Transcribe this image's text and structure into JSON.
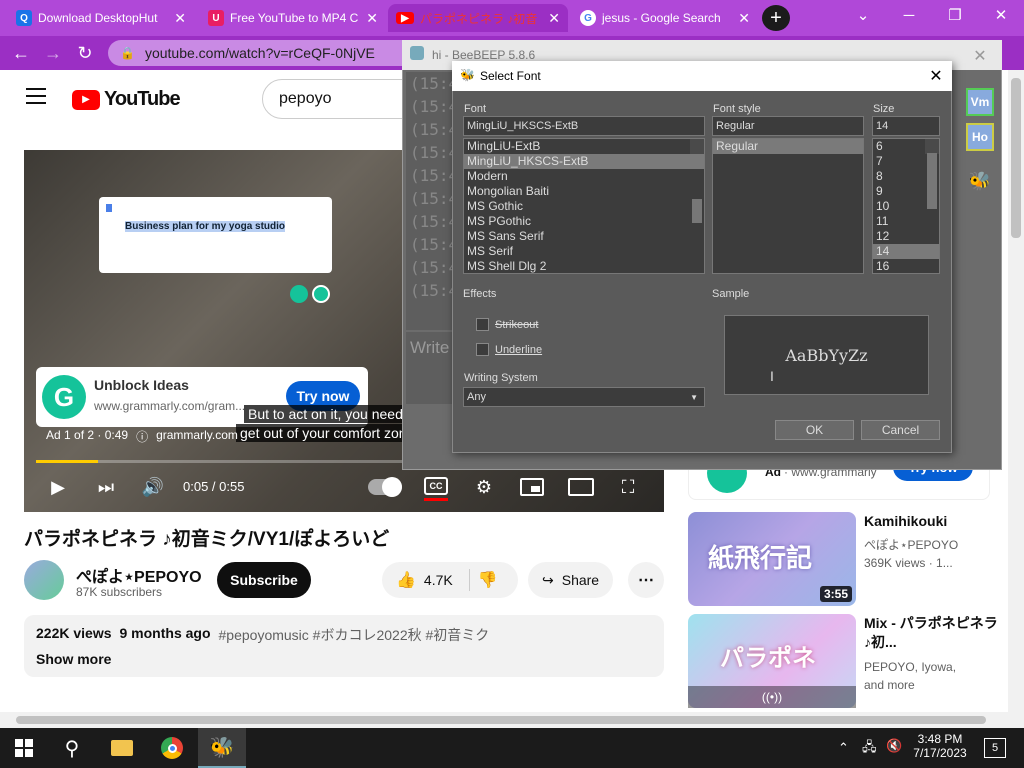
{
  "tabs": [
    {
      "label": "Download DesktopHut",
      "icon": "desktophut-icon",
      "color": "#1a73e8"
    },
    {
      "label": "Free YouTube to MP4 C",
      "icon": "converter-icon",
      "color": "#e91e63"
    },
    {
      "label": "パラポネピネラ ♪初音",
      "icon": "youtube-icon",
      "color": "#ff0000"
    },
    {
      "label": "jesus - Google Search",
      "icon": "google-icon",
      "color": "#4285f4"
    }
  ],
  "browser": {
    "url": "youtube.com/watch?v=rCeQF-0NjVE",
    "accent": "#9b2fc4"
  },
  "youtube": {
    "logo_text": "YouTube",
    "search_value": "pepoyo",
    "video": {
      "doc_text": "Business plan for my yoga studio",
      "ad_title": "Unblock Ideas",
      "ad_url": "www.grammarly.com/gram...",
      "ad_cta": "Try now",
      "subtitle_line1": "But to act on it, you need to",
      "subtitle_line2": "get out of your comfort zone",
      "ad_counter": "Ad 1 of 2 · 0:49",
      "ad_domain": "grammarly.com",
      "time": "0:05 / 0:55",
      "progress": 0.1
    },
    "title": "パラポネピネラ ♪初音ミク/VY1/ぽよろいど",
    "channel": {
      "name": "ぺぽよ⋆PEPOYO",
      "subscribers": "87K subscribers",
      "subscribe_label": "Subscribe"
    },
    "actions": {
      "likes": "4.7K",
      "share": "Share"
    },
    "description": {
      "views": "222K views",
      "ago": "9 months ago",
      "tags": "#pepoyomusic #ボカコレ2022秋 #初音ミク",
      "show_more": "Show more"
    },
    "sidebar_ad": {
      "ad_label": "Ad",
      "domain": "· www.grammarly",
      "cta": "Try now"
    },
    "recommendations": [
      {
        "title": "Kamihikouki",
        "channel": "ぺぽよ⋆PEPOYO",
        "meta": "369K views · 1...",
        "duration": "3:55",
        "thumb_text": "紙飛行記"
      },
      {
        "title": "Mix - パラポネピネラ ♪初...",
        "channel": "PEPOYO, Iyowa,",
        "meta": "and more",
        "duration": "",
        "thumb_text": "パラポネ"
      }
    ]
  },
  "beebeep": {
    "title": "hi - BeeBEEP 5.8.6",
    "log_lines": [
      "(15:4",
      "(15:4",
      "(15:4",
      "(15:4",
      "(15:4",
      "(15:4",
      "(15:4",
      "(15:4",
      "(15:4",
      "(15:4"
    ],
    "write_placeholder": "Write",
    "side_badges": [
      "Vm",
      "Ho"
    ]
  },
  "font_dialog": {
    "title": "Select Font",
    "font_label": "Font",
    "font_value": "MingLiU_HKSCS-ExtB",
    "fonts": [
      "MingLiU-ExtB",
      "MingLiU_HKSCS-ExtB",
      "Modern",
      "Mongolian Baiti",
      "MS Gothic",
      "MS PGothic",
      "MS Sans Serif",
      "MS Serif",
      "MS Shell Dlg 2"
    ],
    "font_selected_index": 1,
    "style_label": "Font style",
    "style_value": "Regular",
    "styles": [
      "Regular"
    ],
    "size_label": "Size",
    "size_value": "14",
    "sizes": [
      "6",
      "7",
      "8",
      "9",
      "10",
      "11",
      "12",
      "14",
      "16"
    ],
    "size_selected_index": 7,
    "effects_label": "Effects",
    "strikeout": "Strikeout",
    "underline": "Underline",
    "writing_system_label": "Writing System",
    "writing_system_value": "Any",
    "sample_label": "Sample",
    "sample_text": "AaBbYyZz",
    "ok": "OK",
    "cancel": "Cancel"
  },
  "taskbar": {
    "time": "3:48 PM",
    "date": "7/17/2023",
    "notifications": "5"
  }
}
